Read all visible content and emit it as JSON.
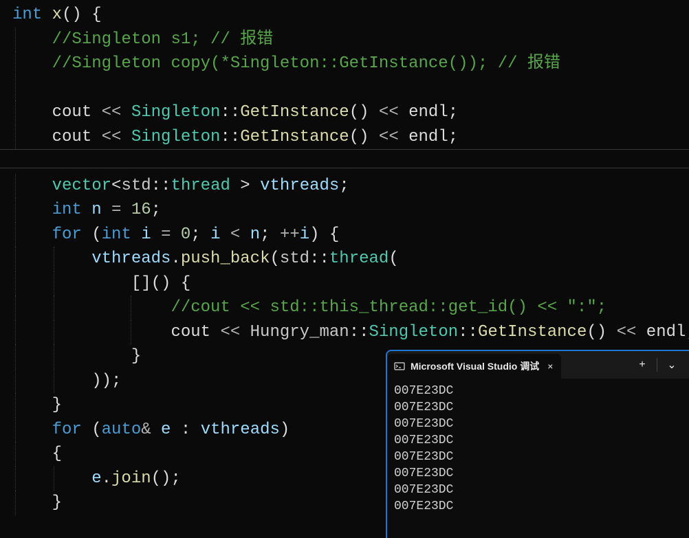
{
  "code": {
    "l1_int": "int",
    "l1_x": "x",
    "l1_rest": "() {",
    "l2_comment": "//Singleton s1; // 报错",
    "l3_comment": "//Singleton copy(*Singleton::GetInstance()); // 报错",
    "l5_cout": "cout",
    "l5_lshift": " << ",
    "l5_Singleton": "Singleton",
    "l5_dcolon": "::",
    "l5_GetInstance": "GetInstance",
    "l5_parens": "()",
    "l5_lshift2": " << ",
    "l5_endl": "endl",
    "l5_semi": ";",
    "l8_vector": "vector",
    "l8_lt": "<",
    "l8_std": "std",
    "l8_thread": "thread",
    "l8_gt": " >",
    "l8_vthreads": " vthreads",
    "l8_semi": ";",
    "l9_int": "int",
    "l9_n": " n",
    "l9_eq": " = ",
    "l9_16": "16",
    "l9_semi": ";",
    "l10_for": "for",
    "l10_open": " (",
    "l10_int": "int",
    "l10_i": " i",
    "l10_eq": " = ",
    "l10_0": "0",
    "l10_semi1": "; ",
    "l10_i2": "i",
    "l10_lt": " < ",
    "l10_n": "n",
    "l10_semi2": "; ",
    "l10_pp": "++",
    "l10_i3": "i",
    "l10_close": ") {",
    "l11_vthreads": "vthreads",
    "l11_dot": ".",
    "l11_push_back": "push_back",
    "l11_open": "(",
    "l11_std": "std",
    "l11_dcolon": "::",
    "l11_thread": "thread",
    "l11_open2": "(",
    "l12_lambda": "[]() {",
    "l13_comment": "//cout << std::this_thread::get_id() << \":\";",
    "l14_cout": "cout",
    "l14_lshift": " << ",
    "l14_Hungry": "Hungry_man",
    "l14_dcolon": "::",
    "l14_Singleton": "Singleton",
    "l14_GetInstance": "GetInstance",
    "l14_parens": "()",
    "l14_lshift2": " << ",
    "l14_endl": "endl",
    "l14_semi": ";",
    "l15_close": "}",
    "l16_close": "));",
    "l17_close": "}",
    "l18_for": "for",
    "l18_open": " (",
    "l18_auto": "auto",
    "l18_amp": "&",
    "l18_e": " e",
    "l18_colon": " : ",
    "l18_vthreads": "vthreads",
    "l18_close": ")",
    "l19_open": "{",
    "l20_e": "e",
    "l20_dot": ".",
    "l20_join": "join",
    "l20_parens": "();",
    "l21_close": "}"
  },
  "terminal": {
    "tab_title": "Microsoft Visual Studio 调试",
    "tab_close": "×",
    "add": "+",
    "dropdown": "⌄",
    "lines": [
      "007E23DC",
      "007E23DC",
      "007E23DC",
      "007E23DC",
      "007E23DC",
      "007E23DC",
      "007E23DC",
      "007E23DC"
    ]
  }
}
